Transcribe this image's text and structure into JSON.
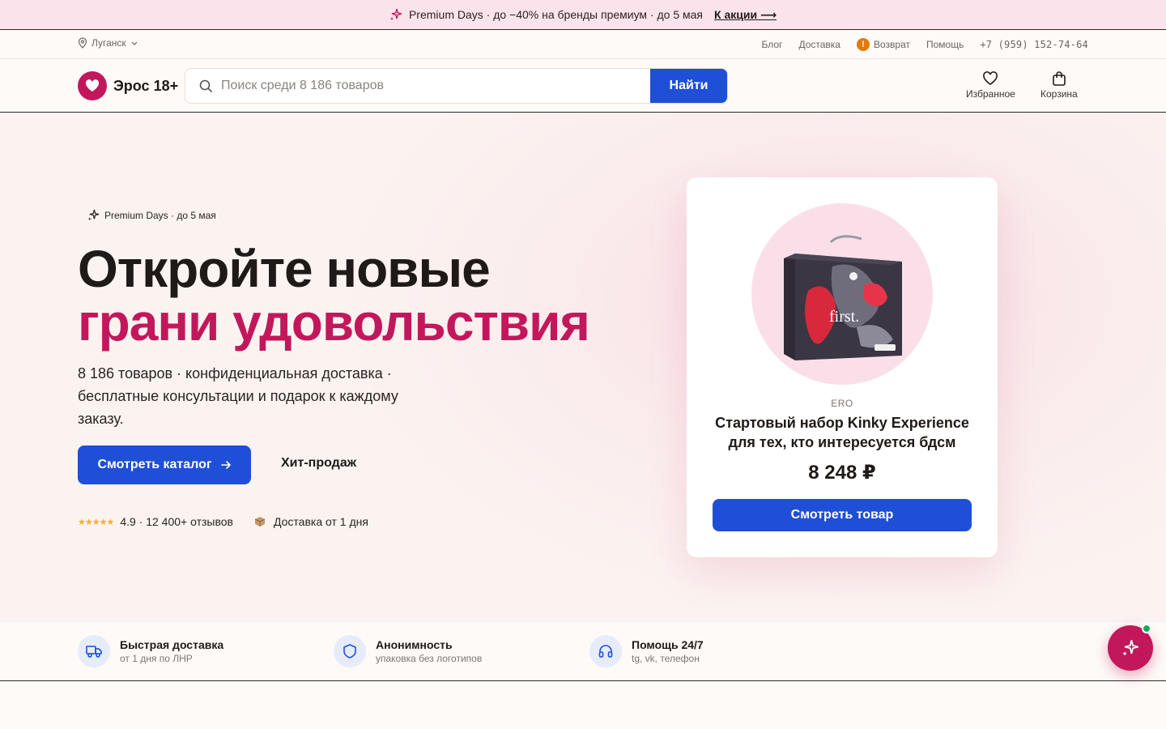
{
  "promo": {
    "text": "Premium Days · до −40% на бренды премиум · до 5 мая",
    "link": "К акции ⟶"
  },
  "util": {
    "city": "Луганск",
    "links": {
      "blog": "Блог",
      "delivery": "Доставка",
      "returns": "Возврат",
      "help": "Помощь",
      "phone": "+7 (959) 152-74-64"
    }
  },
  "header": {
    "logo": "Эрос 18+",
    "search_placeholder": "Поиск среди 8 186 товаров",
    "search_button": "Найти",
    "favorites": "Избранное",
    "cart": "Корзина"
  },
  "hero": {
    "badge": "Premium Days · до 5 мая",
    "title_line1": "Откройте новые",
    "title_line2": "грани удовольствия",
    "subtitle": "8 186 товаров · конфиденциальная доставка · бесплатные консультации и подарок к каждому заказу.",
    "catalog_button": "Смотреть каталог",
    "hits_button": "Хит-продаж",
    "stars": "★★★★★",
    "rating": "4.9 · 12 400+ отзывов",
    "delivery": "Доставка от 1 дня"
  },
  "product": {
    "brand": "ERO",
    "title": "Стартовый набор Kinky Experience для тех, кто интересуется бдсм",
    "price": "8 248 ₽",
    "button": "Смотреть товар",
    "box_text": "first."
  },
  "features": [
    {
      "title": "Быстрая доставка",
      "subtitle": "от 1 дня по ЛНР",
      "icon": "truck-icon"
    },
    {
      "title": "Анонимность",
      "subtitle": "упаковка без логотипов",
      "icon": "shield-icon"
    },
    {
      "title": "Помощь 24/7",
      "subtitle": "tg, vk, телефон",
      "icon": "headphones-icon"
    }
  ],
  "colors": {
    "accent": "#c2185b",
    "primary": "#1f4fd6",
    "promo_bg": "#fbe3ec",
    "online": "#19a85b"
  }
}
